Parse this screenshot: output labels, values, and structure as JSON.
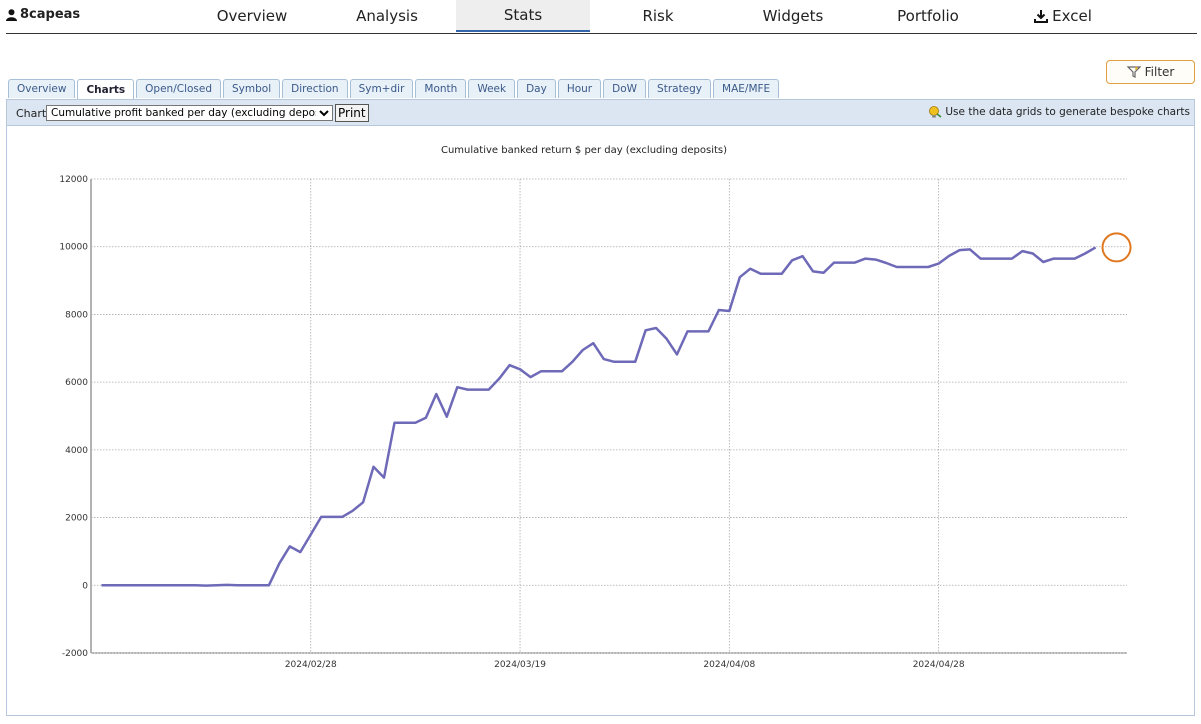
{
  "user": {
    "name": "8capeas"
  },
  "nav": {
    "items": [
      "Overview",
      "Analysis",
      "Stats",
      "Risk",
      "Widgets",
      "Portfolio"
    ],
    "active": "Stats",
    "excel": "Excel"
  },
  "filter_label": "Filter",
  "tabs": [
    "Overview",
    "Charts",
    "Open/Closed",
    "Symbol",
    "Direction",
    "Sym+dir",
    "Month",
    "Week",
    "Day",
    "Hour",
    "DoW",
    "Strategy",
    "MAE/MFE"
  ],
  "active_tab": "Charts",
  "toolbar": {
    "chart_label": "Chart:",
    "chart_selected": "Cumulative profit banked per day (excluding deposits)",
    "print_label": "Print",
    "hint": "Use the data grids to generate bespoke charts"
  },
  "colors": {
    "line": "#6e6ab8",
    "highlight": "#e07820",
    "accent": "#3366aa"
  },
  "chart_data": {
    "type": "line",
    "title": "Cumulative banked return $ per day (excluding deposits)",
    "ylim": [
      -2000,
      12000
    ],
    "yticks": [
      -2000,
      0,
      2000,
      4000,
      6000,
      8000,
      10000,
      12000
    ],
    "xticks": [
      "2024/02/28",
      "2024/03/19",
      "2024/04/08",
      "2024/04/28"
    ],
    "x_range": [
      "2024/02/07",
      "2024/05/16"
    ],
    "grid": true,
    "x": [
      "2024/02/08",
      "2024/02/09",
      "2024/02/10",
      "2024/02/11",
      "2024/02/12",
      "2024/02/13",
      "2024/02/14",
      "2024/02/15",
      "2024/02/16",
      "2024/02/17",
      "2024/02/18",
      "2024/02/19",
      "2024/02/20",
      "2024/02/21",
      "2024/02/22",
      "2024/02/23",
      "2024/02/24",
      "2024/02/25",
      "2024/02/26",
      "2024/02/27",
      "2024/02/28",
      "2024/02/29",
      "2024/03/01",
      "2024/03/02",
      "2024/03/03",
      "2024/03/04",
      "2024/03/05",
      "2024/03/06",
      "2024/03/07",
      "2024/03/08",
      "2024/03/09",
      "2024/03/10",
      "2024/03/11",
      "2024/03/12",
      "2024/03/13",
      "2024/03/14",
      "2024/03/15",
      "2024/03/16",
      "2024/03/17",
      "2024/03/18",
      "2024/03/19",
      "2024/03/20",
      "2024/03/21",
      "2024/03/22",
      "2024/03/23",
      "2024/03/24",
      "2024/03/25",
      "2024/03/26",
      "2024/03/27",
      "2024/03/28",
      "2024/03/29",
      "2024/03/30",
      "2024/03/31",
      "2024/04/01",
      "2024/04/02",
      "2024/04/03",
      "2024/04/04",
      "2024/04/05",
      "2024/04/06",
      "2024/04/07",
      "2024/04/08",
      "2024/04/09",
      "2024/04/10",
      "2024/04/11",
      "2024/04/12",
      "2024/04/13",
      "2024/04/14",
      "2024/04/15",
      "2024/04/16",
      "2024/04/17",
      "2024/04/18",
      "2024/04/19",
      "2024/04/20",
      "2024/04/21",
      "2024/04/22",
      "2024/04/23",
      "2024/04/24",
      "2024/04/25",
      "2024/04/26",
      "2024/04/27",
      "2024/04/28",
      "2024/04/29",
      "2024/04/30",
      "2024/05/01",
      "2024/05/02",
      "2024/05/03",
      "2024/05/04",
      "2024/05/05",
      "2024/05/06",
      "2024/05/07",
      "2024/05/08",
      "2024/05/09",
      "2024/05/10",
      "2024/05/11",
      "2024/05/12",
      "2024/05/13",
      "2024/05/14",
      "2024/05/15"
    ],
    "series": [
      {
        "values": [
          0,
          0,
          0,
          0,
          0,
          0,
          0,
          0,
          0,
          0,
          -10,
          0,
          10,
          0,
          0,
          0,
          0,
          650,
          1150,
          980,
          1500,
          2020,
          2020,
          2020,
          2200,
          2450,
          3500,
          3180,
          4800,
          4800,
          4800,
          4950,
          5650,
          4980,
          5850,
          5780,
          5780,
          5780,
          6100,
          6500,
          6380,
          6150,
          6320,
          6320,
          6320,
          6600,
          6950,
          7150,
          6680,
          6600,
          6600,
          6600,
          7530,
          7600,
          7280,
          6820,
          7500,
          7500,
          7500,
          8130,
          8100,
          9100,
          9350,
          9200,
          9200,
          9200,
          9600,
          9720,
          9270,
          9230,
          9530,
          9530,
          9530,
          9650,
          9620,
          9520,
          9400,
          9400,
          9400,
          9400,
          9500,
          9730,
          9900,
          9920,
          9650,
          9650,
          9650,
          9650,
          9870,
          9800,
          9550,
          9650,
          9650,
          9650,
          9800,
          9980
        ]
      }
    ],
    "highlight_point": {
      "x": "2024/05/15",
      "y": 9980
    }
  }
}
